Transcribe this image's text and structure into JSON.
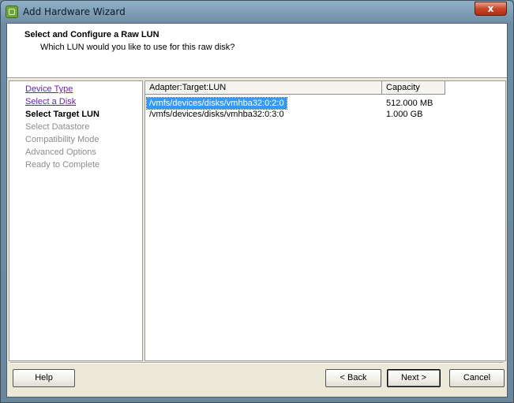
{
  "window": {
    "title": "Add Hardware Wizard",
    "close_label": "x"
  },
  "header": {
    "title": "Select and Configure a Raw LUN",
    "subtitle": "Which LUN would you like to use for this raw disk?"
  },
  "steps": [
    {
      "label": "Device Type",
      "state": "completed"
    },
    {
      "label": "Select a Disk",
      "state": "completed"
    },
    {
      "label": "Select Target LUN",
      "state": "current"
    },
    {
      "label": "Select Datastore",
      "state": "pending"
    },
    {
      "label": "Compatibility Mode",
      "state": "pending"
    },
    {
      "label": "Advanced Options",
      "state": "pending"
    },
    {
      "label": "Ready to Complete",
      "state": "pending"
    }
  ],
  "lun_table": {
    "columns": [
      "Adapter:Target:LUN",
      "Capacity"
    ],
    "rows": [
      {
        "path": "/vmfs/devices/disks/vmhba32:0:2:0",
        "capacity": "512.000 MB",
        "selected": true
      },
      {
        "path": "/vmfs/devices/disks/vmhba32:0:3:0",
        "capacity": "1.000 GB",
        "selected": false
      }
    ]
  },
  "buttons": {
    "help": "Help",
    "back": "< Back",
    "next": "Next >",
    "cancel": "Cancel"
  },
  "colors": {
    "selection": "#3399ff",
    "link_visited": "#6a1fb0",
    "close_red": "#c8462a"
  }
}
